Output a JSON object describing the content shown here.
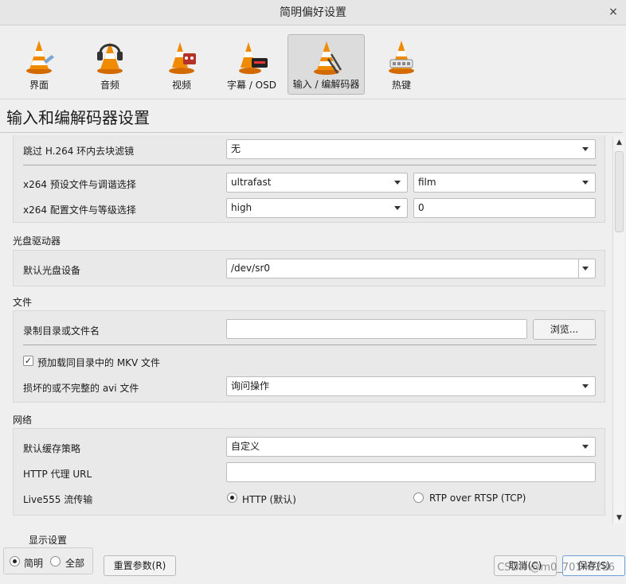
{
  "window": {
    "title": "简明偏好设置",
    "close_glyph": "×"
  },
  "toolbar": {
    "items": [
      {
        "label": "界面",
        "icon": "cone-interface-icon"
      },
      {
        "label": "音频",
        "icon": "cone-headphones-icon"
      },
      {
        "label": "视频",
        "icon": "cone-video-icon"
      },
      {
        "label": "字幕 / OSD",
        "icon": "cone-subtitle-icon"
      },
      {
        "label": "输入 / 编解码器",
        "icon": "cone-codec-icon",
        "active": true
      },
      {
        "label": "热键",
        "icon": "cone-hotkeys-icon"
      }
    ]
  },
  "page_title": "输入和编解码器设置",
  "codecs": {
    "skip_loop_filter": {
      "label": "跳过 H.264 环内去块滤镜",
      "value": "无"
    },
    "x264_preset": {
      "label": "x264 预设文件与调谐选择",
      "preset": "ultrafast",
      "tune": "film"
    },
    "x264_profile": {
      "label": "x264 配置文件与等级选择",
      "profile": "high",
      "level": "0"
    }
  },
  "optical": {
    "heading": "光盘驱动器",
    "default_device": {
      "label": "默认光盘设备",
      "value": "/dev/sr0"
    }
  },
  "files": {
    "heading": "文件",
    "record_dir": {
      "label": "录制目录或文件名",
      "value": "",
      "browse": "浏览..."
    },
    "preload_mkv": {
      "label": "预加载同目录中的 MKV 文件",
      "checked": "✓"
    },
    "broken_avi": {
      "label": "损坏的或不完整的 avi 文件",
      "value": "询问操作"
    }
  },
  "network": {
    "heading": "网络",
    "cache_policy": {
      "label": "默认缓存策略",
      "value": "自定义"
    },
    "http_proxy": {
      "label": "HTTP 代理 URL",
      "value": ""
    },
    "live555": {
      "label": "Live555 流传输",
      "opt_http": "HTTP (默认)",
      "opt_rtsp": "RTP over RTSP (TCP)",
      "selected": "HTTP (默认)"
    }
  },
  "bottom": {
    "show_settings": "显示设置",
    "simple": "简明",
    "all": "全部",
    "reset": "重置参数(R)",
    "cancel": "取消(C)",
    "save": "保存(S)"
  },
  "watermark": "CSDN @m0_70146286",
  "colors": {
    "primary_border": "#6f9fd8",
    "cone_orange": "#f08a00"
  }
}
